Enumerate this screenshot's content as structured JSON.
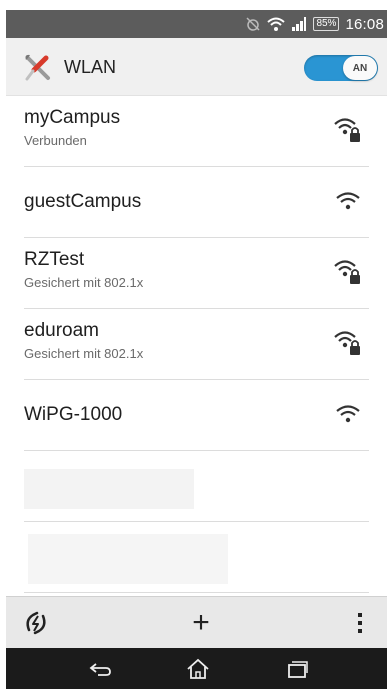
{
  "status_bar": {
    "battery": "85%",
    "time": "16:08",
    "icons": [
      "alarm-off-icon",
      "wifi-status-icon",
      "signal-icon"
    ]
  },
  "header": {
    "title": "WLAN",
    "icon": "wrench-screwdriver-icon",
    "toggle_label": "AN",
    "toggle_state": "on",
    "accent_color": "#2a95d3"
  },
  "networks": [
    {
      "name": "myCampus",
      "status": "Verbunden",
      "secured": true
    },
    {
      "name": "guestCampus",
      "status": "",
      "secured": false
    },
    {
      "name": "RZTest",
      "status": "Gesichert mit 802.1x",
      "secured": true
    },
    {
      "name": "eduroam",
      "status": "Gesichert mit 802.1x",
      "secured": true
    },
    {
      "name": "WiPG-1000",
      "status": "",
      "secured": false
    }
  ],
  "bottom_bar": {
    "icons": [
      "scan-refresh-icon",
      "add-network-icon",
      "overflow-menu-icon"
    ],
    "add_label": "+"
  },
  "nav_bar": {
    "icons": [
      "back-icon",
      "home-icon",
      "recent-apps-icon"
    ]
  }
}
